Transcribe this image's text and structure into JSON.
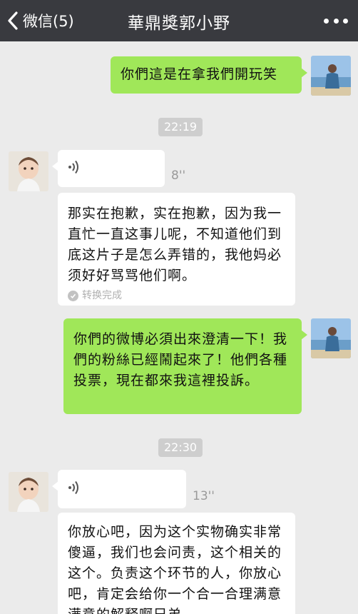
{
  "header": {
    "back_label": "微信(5)",
    "title": "華鼎獎郭小野",
    "more_icon": "more-icon"
  },
  "messages": {
    "m1": {
      "text": "你們這是在拿我們開玩笑"
    },
    "t1": "22:19",
    "v1": {
      "duration": "8''"
    },
    "tr1": {
      "text": "那实在抱歉，实在抱歉，因为我一直忙一直这事儿呢，不知道他们到底这片子是怎么弄错的，我他妈必须好好骂骂他们啊。",
      "status": "转换完成"
    },
    "m2": {
      "text": "你們的微博必須出來澄清一下！我們的粉絲已經鬧起來了！他們各種投票，現在都來我這裡投訴。"
    },
    "t2": "22:30",
    "v2": {
      "duration": "13''"
    },
    "tr2": {
      "text": "你放心吧，因为这个实物确实非常傻逼，我们也会问责，这个相关的这个。负责这个环节的人，你放心吧，肯定会给你一个合一合理满意满意的解释啊兄弟。"
    }
  },
  "colors": {
    "navbar": "#393a3f",
    "background": "#ebebeb",
    "sent_bubble": "#a0e759",
    "received_bubble": "#ffffff",
    "time_pill": "#cecece"
  }
}
